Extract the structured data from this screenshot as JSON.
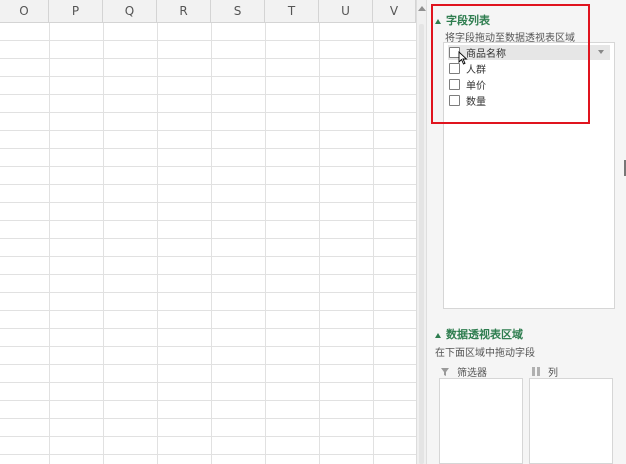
{
  "sheet": {
    "columns": [
      "O",
      "P",
      "Q",
      "R",
      "S",
      "T",
      "U",
      "V"
    ]
  },
  "pivot_pane": {
    "field_list": {
      "title": "字段列表",
      "hint": "将字段拖动至数据透视表区域",
      "fields": [
        {
          "label": "商品名称",
          "checked": false,
          "hovered": true
        },
        {
          "label": "人群",
          "checked": false
        },
        {
          "label": "单价",
          "checked": false
        },
        {
          "label": "数量",
          "checked": false
        }
      ]
    },
    "areas": {
      "title": "数据透视表区域",
      "hint": "在下面区域中拖动字段",
      "filter_label": "筛选器",
      "columns_label": "列"
    }
  },
  "colors": {
    "accent_green": "#2e7d4f",
    "highlight_red": "#e0141e"
  },
  "icons": [
    "triangle-collapse-icon",
    "chevron-down-icon",
    "mouse-cursor-icon",
    "filter-icon",
    "columns-icon"
  ]
}
